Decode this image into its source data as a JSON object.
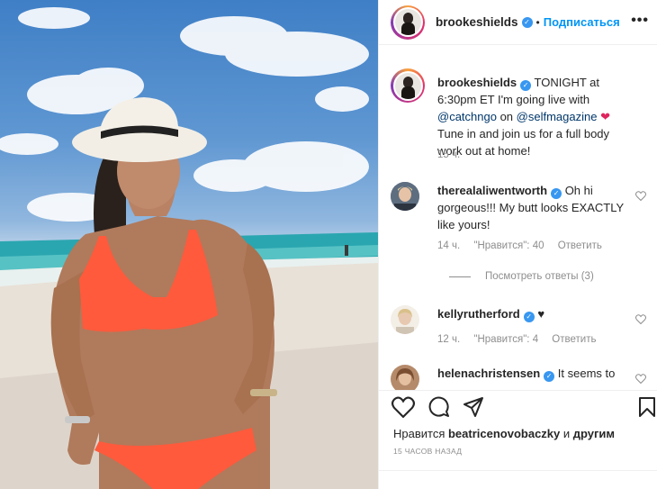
{
  "header": {
    "username": "brookeshields",
    "separator": "•",
    "follow_label": "Подписаться",
    "more_label": "•••"
  },
  "caption": {
    "username": "brookeshields",
    "text_1": " TONIGHT at 6:30pm ET I'm going live with ",
    "mention_1": "@catchngo",
    "text_2": " on ",
    "mention_2": "@selfmagazine",
    "text_3": " Tune in and join us for a full body work out at home!",
    "time": "15 ч."
  },
  "comments": [
    {
      "username": "therealaliwentworth",
      "text": " Oh hi gorgeous!!! My butt looks EXACTLY like yours!",
      "time": "14 ч.",
      "likes": "\"Нравится\": 40",
      "reply": "Ответить",
      "view_replies": "Посмотреть ответы (3)"
    },
    {
      "username": "kellyrutherford",
      "text": " ♥",
      "time": "12 ч.",
      "likes": "\"Нравится\": 4",
      "reply": "Ответить"
    },
    {
      "username": "helenachristensen",
      "text": " It seems to"
    }
  ],
  "likes": {
    "prefix": "Нравится ",
    "user": "beatricenovobaczky",
    "suffix": " и ",
    "others": "другим"
  },
  "timestamp": "15 ЧАСОВ НАЗАД",
  "colors": {
    "accent": "#0095f6",
    "verified": "#3897f0",
    "muted": "#8e8e8e"
  }
}
